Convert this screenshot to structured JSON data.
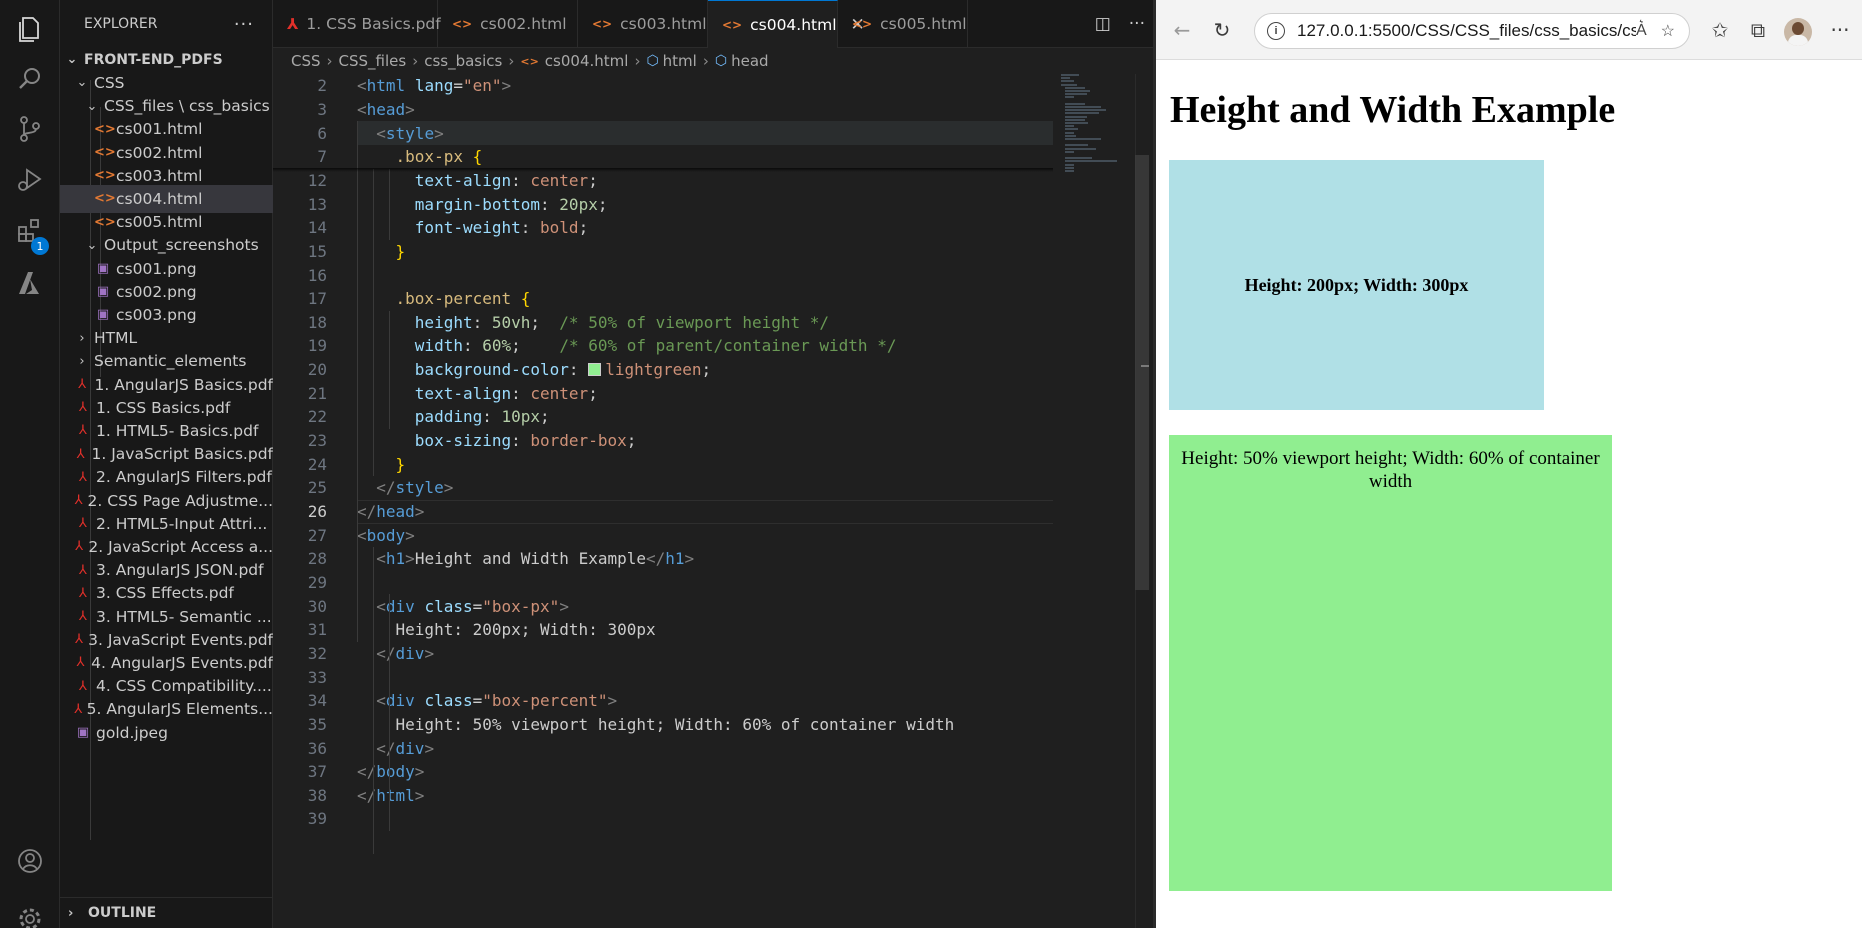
{
  "explorer": {
    "title": "EXPLORER",
    "more": "···",
    "outline": "OUTLINE",
    "tree": [
      {
        "label": "FRONT-END_PDFS",
        "type": "folder-root"
      },
      {
        "label": "CSS",
        "type": "folder"
      },
      {
        "label": "CSS_files \\ css_basics",
        "type": "folder"
      },
      {
        "label": "cs001.html",
        "type": "html"
      },
      {
        "label": "cs002.html",
        "type": "html"
      },
      {
        "label": "cs003.html",
        "type": "html"
      },
      {
        "label": "cs004.html",
        "type": "html",
        "selected": true
      },
      {
        "label": "cs005.html",
        "type": "html"
      },
      {
        "label": "Output_screenshots",
        "type": "folder"
      },
      {
        "label": "cs001.png",
        "type": "png"
      },
      {
        "label": "cs002.png",
        "type": "png"
      },
      {
        "label": "cs003.png",
        "type": "png"
      },
      {
        "label": "HTML",
        "type": "folder-collapsed"
      },
      {
        "label": "Semantic_elements",
        "type": "folder-collapsed"
      },
      {
        "label": "1. AngularJS Basics.pdf",
        "type": "pdf"
      },
      {
        "label": "1. CSS Basics.pdf",
        "type": "pdf"
      },
      {
        "label": "1. HTML5- Basics.pdf",
        "type": "pdf"
      },
      {
        "label": "1. JavaScript Basics.pdf",
        "type": "pdf"
      },
      {
        "label": "2. AngularJS Filters.pdf",
        "type": "pdf"
      },
      {
        "label": "2. CSS Page Adjustme...",
        "type": "pdf"
      },
      {
        "label": "2. HTML5-Input Attri...",
        "type": "pdf"
      },
      {
        "label": "2. JavaScript Access a...",
        "type": "pdf"
      },
      {
        "label": "3. AngularJS JSON.pdf",
        "type": "pdf"
      },
      {
        "label": "3. CSS Effects.pdf",
        "type": "pdf"
      },
      {
        "label": "3. HTML5- Semantic ...",
        "type": "pdf"
      },
      {
        "label": "3. JavaScript Events.pdf",
        "type": "pdf"
      },
      {
        "label": "4. AngularJS Events.pdf",
        "type": "pdf"
      },
      {
        "label": "4. CSS Compatibility....",
        "type": "pdf"
      },
      {
        "label": "5. AngularJS Elements...",
        "type": "pdf"
      },
      {
        "label": "gold.jpeg",
        "type": "jpeg"
      }
    ]
  },
  "activity_bar": {
    "extensions_badge": "1",
    "icons": [
      "files-icon",
      "search-icon",
      "source-control-icon",
      "run-debug-icon",
      "extensions-icon",
      "azure-icon",
      "account-icon",
      "settings-gear-icon"
    ]
  },
  "tabs": [
    {
      "label": "1. CSS Basics.pdf",
      "type": "pdf"
    },
    {
      "label": "cs002.html",
      "type": "html"
    },
    {
      "label": "cs003.html",
      "type": "html"
    },
    {
      "label": "cs004.html",
      "type": "html",
      "active": true
    },
    {
      "label": "cs005.html",
      "type": "html"
    }
  ],
  "tab_actions": {
    "split": "split-editor-icon",
    "more": "···"
  },
  "breadcrumb": [
    "CSS",
    "CSS_files",
    "css_basics",
    "cs004.html",
    "html",
    "head"
  ],
  "code_lines": [
    {
      "n": "2",
      "parts": [
        [
          "t-br",
          "<"
        ],
        [
          "t-tag",
          "html "
        ],
        [
          "t-attr",
          "lang"
        ],
        [
          "t-punc",
          "="
        ],
        [
          "t-str",
          "\"en\""
        ],
        [
          "t-br",
          ">"
        ]
      ]
    },
    {
      "n": "3",
      "parts": [
        [
          "t-br",
          "<"
        ],
        [
          "t-tag",
          "head"
        ],
        [
          "t-br",
          ">"
        ]
      ]
    },
    {
      "n": "6",
      "parts": [
        [
          "t-txt",
          "  "
        ],
        [
          "t-br",
          "<"
        ],
        [
          "t-tag",
          "style"
        ],
        [
          "t-br",
          ">"
        ]
      ],
      "hl": true
    },
    {
      "n": "7",
      "parts": [
        [
          "t-txt",
          "    "
        ],
        [
          "t-sel",
          ".box-px "
        ],
        [
          "t-brace",
          "{"
        ]
      ]
    },
    {
      "n": "12",
      "parts": [
        [
          "t-txt",
          "      "
        ],
        [
          "t-prop",
          "text-align"
        ],
        [
          "t-punc",
          ": "
        ],
        [
          "t-val",
          "center"
        ],
        [
          "t-punc",
          ";"
        ]
      ]
    },
    {
      "n": "13",
      "parts": [
        [
          "t-txt",
          "      "
        ],
        [
          "t-prop",
          "margin-bottom"
        ],
        [
          "t-punc",
          ": "
        ],
        [
          "t-num",
          "20px"
        ],
        [
          "t-punc",
          ";"
        ]
      ]
    },
    {
      "n": "14",
      "parts": [
        [
          "t-txt",
          "      "
        ],
        [
          "t-prop",
          "font-weight"
        ],
        [
          "t-punc",
          ": "
        ],
        [
          "t-val",
          "bold"
        ],
        [
          "t-punc",
          ";"
        ]
      ]
    },
    {
      "n": "15",
      "parts": [
        [
          "t-txt",
          "    "
        ],
        [
          "t-brace",
          "}"
        ]
      ]
    },
    {
      "n": "16",
      "parts": []
    },
    {
      "n": "17",
      "parts": [
        [
          "t-txt",
          "    "
        ],
        [
          "t-sel",
          ".box-percent "
        ],
        [
          "t-brace",
          "{"
        ]
      ]
    },
    {
      "n": "18",
      "parts": [
        [
          "t-txt",
          "      "
        ],
        [
          "t-prop",
          "height"
        ],
        [
          "t-punc",
          ": "
        ],
        [
          "t-num",
          "50vh"
        ],
        [
          "t-punc",
          ";  "
        ],
        [
          "t-cmt",
          "/* 50% of viewport height */"
        ]
      ]
    },
    {
      "n": "19",
      "parts": [
        [
          "t-txt",
          "      "
        ],
        [
          "t-prop",
          "width"
        ],
        [
          "t-punc",
          ": "
        ],
        [
          "t-num",
          "60%"
        ],
        [
          "t-punc",
          ";    "
        ],
        [
          "t-cmt",
          "/* 60% of parent/container width */"
        ]
      ]
    },
    {
      "n": "20",
      "parts": [
        [
          "t-txt",
          "      "
        ],
        [
          "t-prop",
          "background-color"
        ],
        [
          "t-punc",
          ": "
        ],
        [
          "swatch",
          ""
        ],
        [
          "t-val",
          "lightgreen"
        ],
        [
          "t-punc",
          ";"
        ]
      ]
    },
    {
      "n": "21",
      "parts": [
        [
          "t-txt",
          "      "
        ],
        [
          "t-prop",
          "text-align"
        ],
        [
          "t-punc",
          ": "
        ],
        [
          "t-val",
          "center"
        ],
        [
          "t-punc",
          ";"
        ]
      ]
    },
    {
      "n": "22",
      "parts": [
        [
          "t-txt",
          "      "
        ],
        [
          "t-prop",
          "padding"
        ],
        [
          "t-punc",
          ": "
        ],
        [
          "t-num",
          "10px"
        ],
        [
          "t-punc",
          ";"
        ]
      ]
    },
    {
      "n": "23",
      "parts": [
        [
          "t-txt",
          "      "
        ],
        [
          "t-prop",
          "box-sizing"
        ],
        [
          "t-punc",
          ": "
        ],
        [
          "t-val",
          "border-box"
        ],
        [
          "t-punc",
          ";"
        ]
      ]
    },
    {
      "n": "24",
      "parts": [
        [
          "t-txt",
          "    "
        ],
        [
          "t-brace",
          "}"
        ]
      ]
    },
    {
      "n": "25",
      "parts": [
        [
          "t-txt",
          "  "
        ],
        [
          "t-br",
          "</"
        ],
        [
          "t-tag",
          "style"
        ],
        [
          "t-br",
          ">"
        ]
      ]
    },
    {
      "n": "26",
      "parts": [
        [
          "t-br",
          "</"
        ],
        [
          "t-tag",
          "head"
        ],
        [
          "t-br",
          ">"
        ]
      ],
      "current": true
    },
    {
      "n": "27",
      "parts": [
        [
          "t-br",
          "<"
        ],
        [
          "t-tag",
          "body"
        ],
        [
          "t-br",
          ">"
        ]
      ]
    },
    {
      "n": "28",
      "parts": [
        [
          "t-txt",
          "  "
        ],
        [
          "t-br",
          "<"
        ],
        [
          "t-tag",
          "h1"
        ],
        [
          "t-br",
          ">"
        ],
        [
          "t-txt",
          "Height and Width Example"
        ],
        [
          "t-br",
          "</"
        ],
        [
          "t-tag",
          "h1"
        ],
        [
          "t-br",
          ">"
        ]
      ]
    },
    {
      "n": "29",
      "parts": []
    },
    {
      "n": "30",
      "parts": [
        [
          "t-txt",
          "  "
        ],
        [
          "t-br",
          "<"
        ],
        [
          "t-tag",
          "div "
        ],
        [
          "t-attr",
          "class"
        ],
        [
          "t-punc",
          "="
        ],
        [
          "t-str",
          "\"box-px\""
        ],
        [
          "t-br",
          ">"
        ]
      ]
    },
    {
      "n": "31",
      "parts": [
        [
          "t-txt",
          "    Height: 200px; Width: 300px"
        ]
      ]
    },
    {
      "n": "32",
      "parts": [
        [
          "t-txt",
          "  "
        ],
        [
          "t-br",
          "</"
        ],
        [
          "t-tag",
          "div"
        ],
        [
          "t-br",
          ">"
        ]
      ]
    },
    {
      "n": "33",
      "parts": []
    },
    {
      "n": "34",
      "parts": [
        [
          "t-txt",
          "  "
        ],
        [
          "t-br",
          "<"
        ],
        [
          "t-tag",
          "div "
        ],
        [
          "t-attr",
          "class"
        ],
        [
          "t-punc",
          "="
        ],
        [
          "t-str",
          "\"box-percent\""
        ],
        [
          "t-br",
          ">"
        ]
      ]
    },
    {
      "n": "35",
      "parts": [
        [
          "t-txt",
          "    Height: 50% viewport height; Width: 60% of container width"
        ]
      ]
    },
    {
      "n": "36",
      "parts": [
        [
          "t-txt",
          "  "
        ],
        [
          "t-br",
          "</"
        ],
        [
          "t-tag",
          "div"
        ],
        [
          "t-br",
          ">"
        ]
      ]
    },
    {
      "n": "37",
      "parts": [
        [
          "t-br",
          "</"
        ],
        [
          "t-tag",
          "body"
        ],
        [
          "t-br",
          ">"
        ]
      ]
    },
    {
      "n": "38",
      "parts": [
        [
          "t-br",
          "</"
        ],
        [
          "t-tag",
          "html"
        ],
        [
          "t-br",
          ">"
        ]
      ]
    },
    {
      "n": "39",
      "parts": []
    }
  ],
  "browser": {
    "url": "127.0.0.1:5500/CSS/CSS_files/css_basics/cs...",
    "page": {
      "h1": "Height and Width Example",
      "box_px_text": "Height: 200px; Width: 300px",
      "box_percent_text": "Height: 50% viewport height; Width: 60% of container width",
      "box_px_color": "#b0e0e6",
      "box_percent_color": "#90ee90"
    }
  }
}
